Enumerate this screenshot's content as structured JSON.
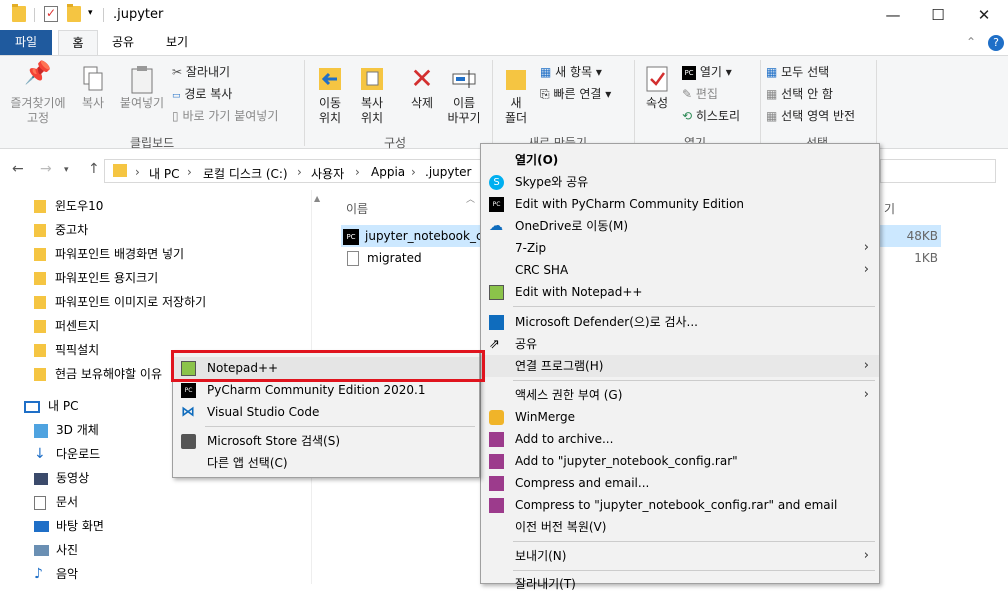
{
  "window": {
    "title": ".jupyter",
    "min": "—",
    "max": "☐",
    "close": "✕"
  },
  "menu": {
    "file": "파일",
    "home": "홈",
    "share": "공유",
    "view": "보기",
    "collapse": "⌃",
    "help": "?"
  },
  "ribbon": {
    "pin": "즐겨찾기에\n고정",
    "copy": "복사",
    "paste": "붙여넣기",
    "cut": "잘라내기",
    "copy_path": "경로 복사",
    "paste_shortcut": "바로 가기 붙여넣기",
    "clipboard": "클립보드",
    "move_to": "이동\n위치",
    "copy_to": "복사\n위치",
    "delete": "삭제",
    "rename": "이름\n바꾸기",
    "organize": "구성",
    "new_folder": "새\n폴더",
    "new_item": "새 항목",
    "easy_access": "빠른 연결",
    "new_group": "새로 만들기",
    "properties": "속성",
    "open": "열기",
    "edit": "편집",
    "history": "히스토리",
    "open_group": "열기",
    "select_all": "모두 선택",
    "select_none": "선택 안 함",
    "invert": "선택 영역 반전",
    "select_group": "선택"
  },
  "address": {
    "back": "←",
    "forward": "→",
    "up": "↑",
    "crumbs": [
      "내 PC",
      "로컬 디스크 (C:)",
      "사용자",
      "Appia",
      ".jupyter"
    ]
  },
  "left_pane": {
    "items": [
      "윈도우10",
      "중고차",
      "파워포인트 배경화면 넣기",
      "파워포인트 용지크기",
      "파워포인트 이미지로 저장하기",
      "퍼센트지",
      "픽픽설치",
      "현금 보유해야할 이유",
      "내 PC",
      "3D 개체",
      "다운로드",
      "동영상",
      "문서",
      "바탕 화면",
      "사진",
      "음악"
    ]
  },
  "files": {
    "col_name": "이름",
    "col_size": "기",
    "rows": [
      {
        "name": "jupyter_notebook_co",
        "size": "48KB"
      },
      {
        "name": "migrated",
        "size": "1KB"
      }
    ]
  },
  "context_menu": {
    "items": [
      "열기(O)",
      "Skype와 공유",
      "Edit with PyCharm Community Edition",
      "OneDrive로 이동(M)",
      "7-Zip",
      "CRC SHA",
      "Edit with Notepad++",
      "Microsoft Defender(으)로 검사...",
      "공유",
      "연결 프로그램(H)",
      "액세스 권한 부여 (G)",
      "WinMerge",
      "Add to archive...",
      "Add to \"jupyter_notebook_config.rar\"",
      "Compress and email...",
      "Compress to \"jupyter_notebook_config.rar\" and email",
      "이전 버전 복원(V)",
      "보내기(N)",
      "잘라내기(T)"
    ]
  },
  "submenu": {
    "items": [
      "Notepad++",
      "PyCharm Community Edition 2020.1",
      "Visual Studio Code",
      "Microsoft Store 검색(S)",
      "다른 앱 선택(C)"
    ]
  },
  "colors": {
    "highlight": "#e0141e",
    "file_tab": "#1f5a9e"
  }
}
